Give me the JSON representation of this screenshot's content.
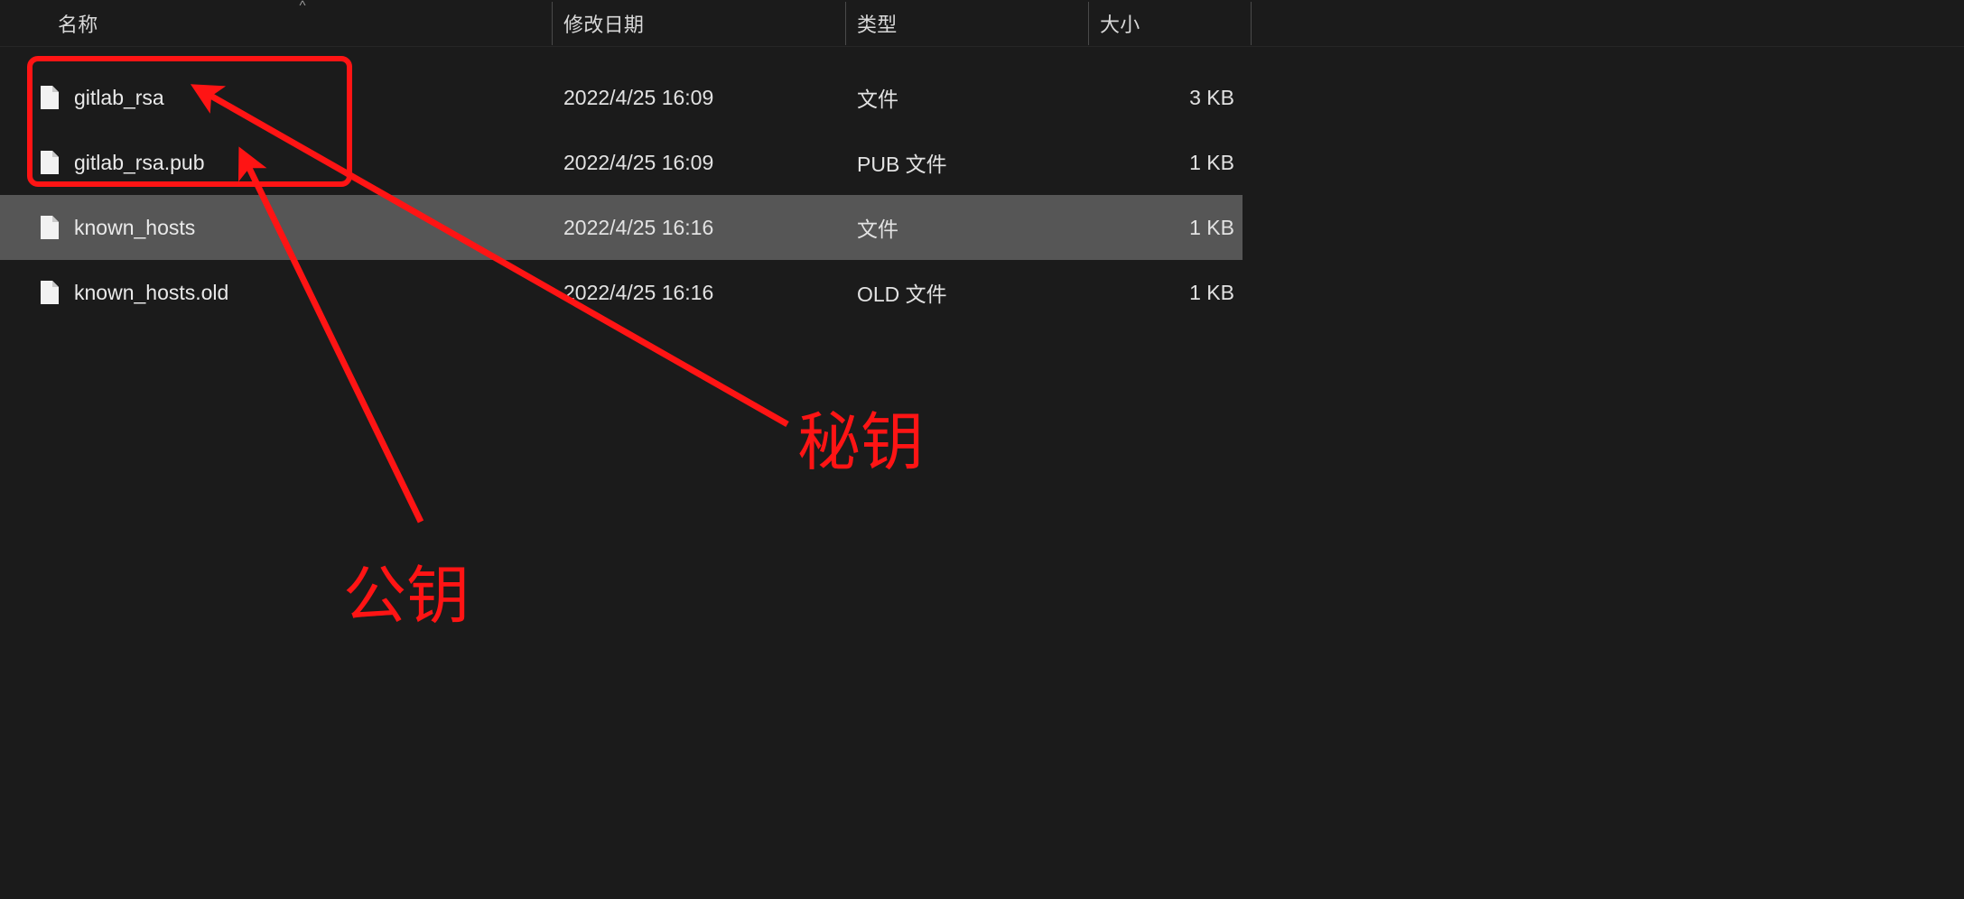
{
  "window": {
    "background_color": "#1b1b1b",
    "selection_color": "#565656",
    "annotation_color": "#ff1414"
  },
  "columns": {
    "name": "名称",
    "date_modified": "修改日期",
    "type": "类型",
    "size": "大小",
    "sort_indicator": "^"
  },
  "files": [
    {
      "name": "gitlab_rsa",
      "date_modified": "2022/4/25 16:09",
      "type": "文件",
      "size": "3 KB",
      "selected": false,
      "icon": "file-icon"
    },
    {
      "name": "gitlab_rsa.pub",
      "date_modified": "2022/4/25 16:09",
      "type": "PUB 文件",
      "size": "1 KB",
      "selected": false,
      "icon": "file-icon"
    },
    {
      "name": "known_hosts",
      "date_modified": "2022/4/25 16:16",
      "type": "文件",
      "size": "1 KB",
      "selected": true,
      "icon": "file-icon"
    },
    {
      "name": "known_hosts.old",
      "date_modified": "2022/4/25 16:16",
      "type": "OLD 文件",
      "size": "1 KB",
      "selected": false,
      "icon": "file-icon"
    }
  ],
  "annotations": {
    "private_key_label": "秘钥",
    "public_key_label": "公钥",
    "highlight_box": "red-rectangle-around-gitlab-rsa-files",
    "arrows": [
      {
        "name": "arrow-to-gitlab_rsa",
        "points_to": "gitlab_rsa",
        "label": "秘钥"
      },
      {
        "name": "arrow-to-gitlab_rsa_pub",
        "points_to": "gitlab_rsa.pub",
        "label": "公钥"
      }
    ]
  }
}
